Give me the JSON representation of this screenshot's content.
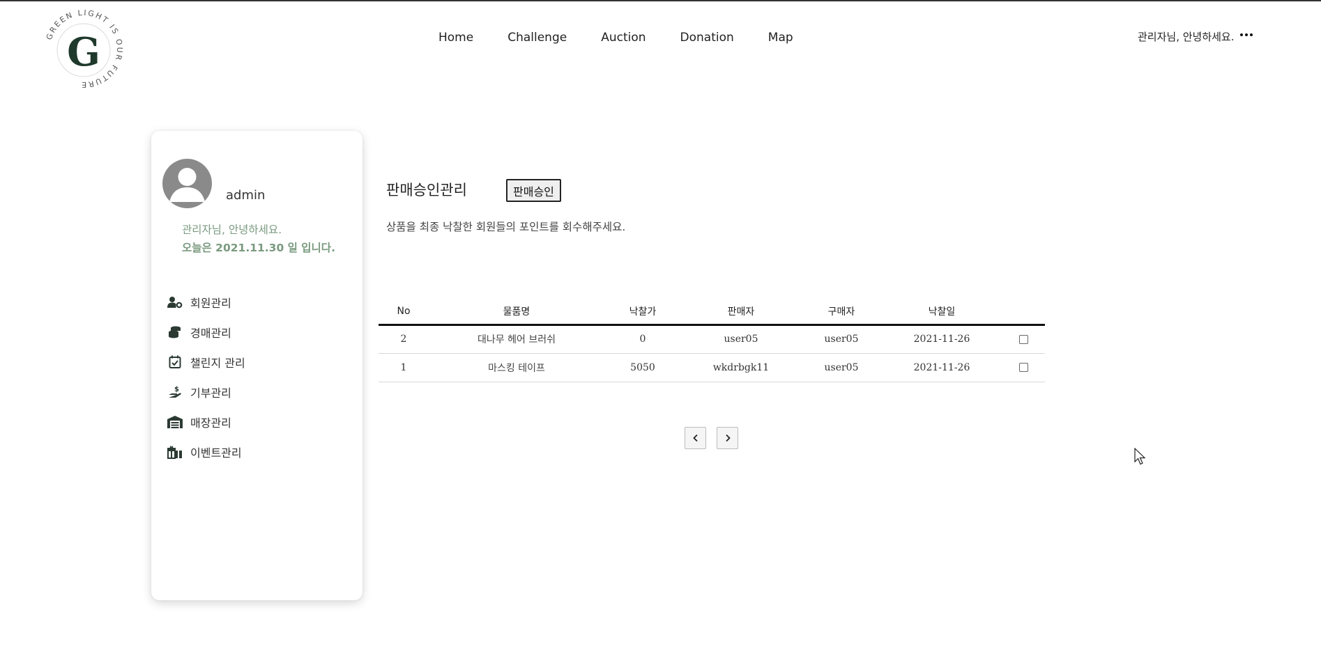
{
  "logo": {
    "letter": "G",
    "ring_text": "GREEN LIGHT IS OUR FUTURE"
  },
  "nav": [
    "Home",
    "Challenge",
    "Auction",
    "Donation",
    "Map"
  ],
  "header": {
    "greeting": "관리자님, 안녕하세요."
  },
  "sidebar": {
    "username": "admin",
    "welcome_line1": "관리자님, 안녕하세요.",
    "welcome_line2": "오늘은 2021.11.30 일 입니다.",
    "items": [
      {
        "label": "회원관리",
        "icon": "user-gear-icon"
      },
      {
        "label": "경매관리",
        "icon": "coins-icon"
      },
      {
        "label": "챌린지 관리",
        "icon": "calendar-check-icon"
      },
      {
        "label": "기부관리",
        "icon": "hand-dollar-icon"
      },
      {
        "label": "매장관리",
        "icon": "warehouse-icon"
      },
      {
        "label": "이벤트관리",
        "icon": "gifts-icon"
      }
    ]
  },
  "main": {
    "title": "판매승인관리",
    "approve_button": "판매승인",
    "subtitle": "상품을 최종 낙찰한 회원들의 포인트를 회수해주세요.",
    "table": {
      "headers": [
        "No",
        "물품명",
        "낙찰가",
        "판매자",
        "구매자",
        "낙찰일",
        ""
      ],
      "rows": [
        {
          "no": "2",
          "item": "대나무 헤어 브러쉬",
          "price": "0",
          "seller": "user05",
          "buyer": "user05",
          "date": "2021-11-26",
          "checked": false
        },
        {
          "no": "1",
          "item": "마스킹 테이프",
          "price": "5050",
          "seller": "wkdrbgk11",
          "buyer": "user05",
          "date": "2021-11-26",
          "checked": false
        }
      ]
    },
    "pagination": {
      "prev_icon": "chevron-left-icon",
      "next_icon": "chevron-right-icon"
    }
  },
  "colors": {
    "accent_green": "#7a9a7f",
    "logo_dark": "#1f3a2c",
    "avatar_gray": "#8a8a8a",
    "header_rule": "#111111"
  }
}
